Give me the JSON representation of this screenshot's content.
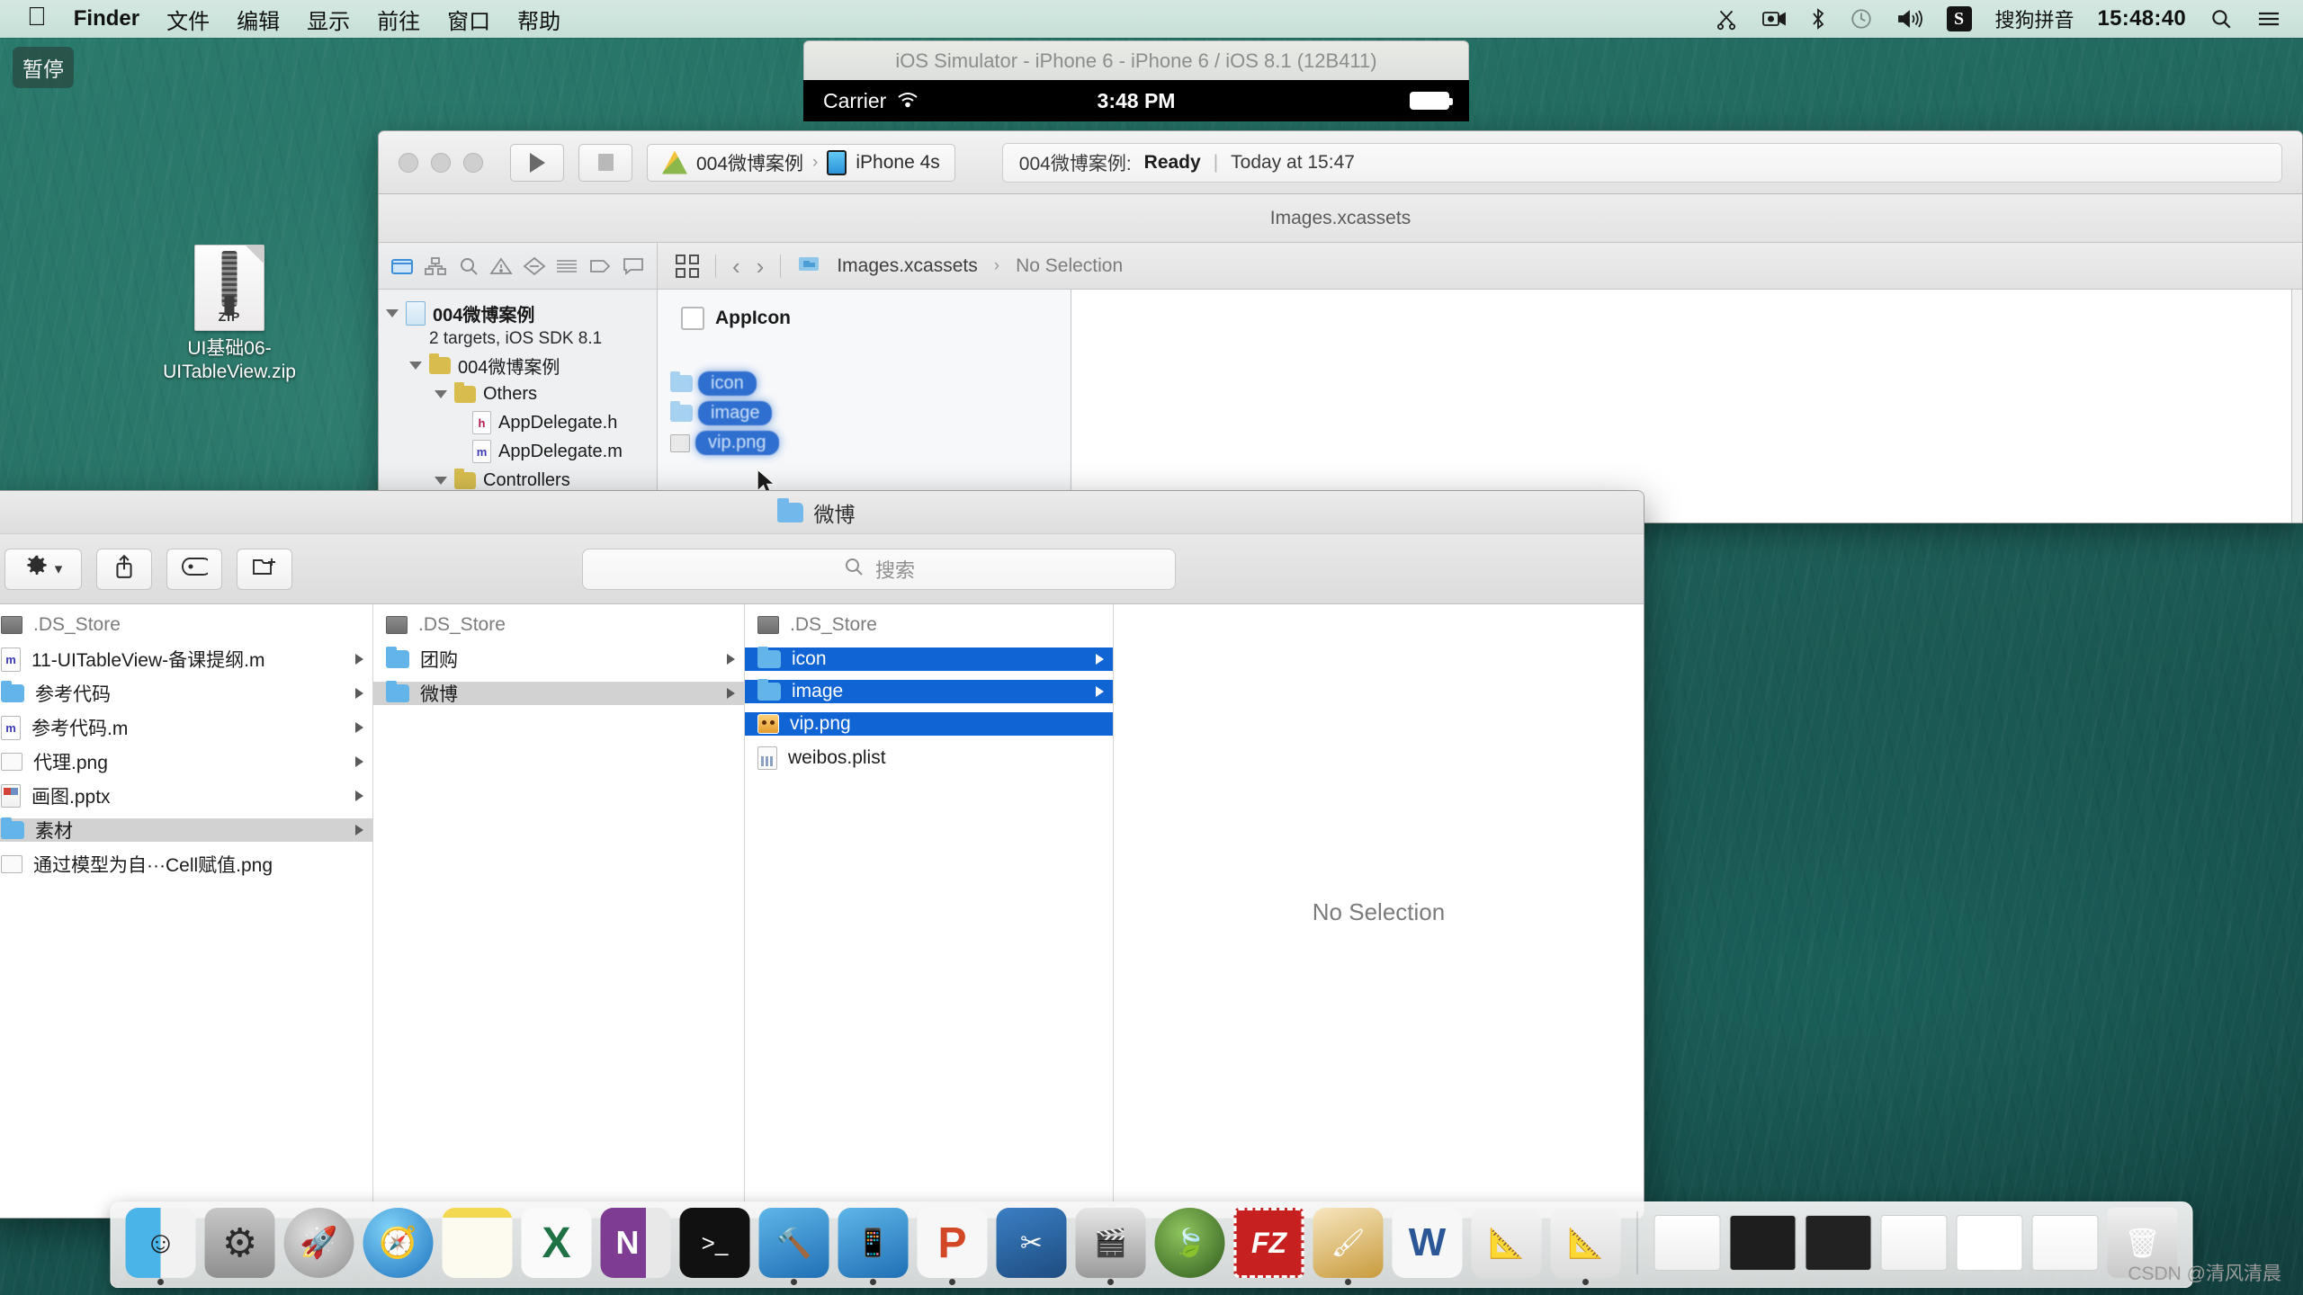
{
  "menubar": {
    "apple_icon": "apple-icon",
    "items": [
      {
        "label": "Finder",
        "bold": true
      },
      {
        "label": "文件",
        "bold": false
      },
      {
        "label": "编辑",
        "bold": false
      },
      {
        "label": "显示",
        "bold": false
      },
      {
        "label": "前往",
        "bold": false
      },
      {
        "label": "窗口",
        "bold": false
      },
      {
        "label": "帮助",
        "bold": false
      }
    ],
    "status_icons": [
      "scissors-icon",
      "screen-record-icon",
      "bluetooth-icon",
      "time-machine-icon",
      "volume-icon"
    ],
    "ime_badge": "S",
    "ime_label": "搜狗拼音",
    "clock": "15:48:40",
    "search_icon": "search-icon",
    "notification_icon": "notification-list-icon"
  },
  "pause_overlay": {
    "label": "暂停"
  },
  "desktop": {
    "zip_file": {
      "name": "UI基础06-UITableView.zip",
      "icon_word": "ZIP"
    }
  },
  "simulator": {
    "title": "iOS Simulator - iPhone 6 - iPhone 6 / iOS 8.1 (12B411)",
    "carrier": "Carrier",
    "wifi_icon": "wifi-icon",
    "time": "3:48 PM",
    "battery_icon": "battery-icon"
  },
  "xcode": {
    "toolbar": {
      "run_icon": "play-icon",
      "stop_icon": "stop-icon",
      "scheme_project": "004微博案例",
      "scheme_separator": "›",
      "scheme_device": "iPhone 4s",
      "status_project": "004微博案例:",
      "status_state": "Ready",
      "status_divider": "|",
      "status_time": "Today at 15:47"
    },
    "subbar_title": "Images.xcassets",
    "navigator": {
      "tabs": [
        "folder-icon",
        "hierarchy-icon",
        "search-icon",
        "warning-icon",
        "issue-icon",
        "test-icon",
        "tag-icon",
        "comment-icon"
      ],
      "tree": [
        {
          "label": "004微博案例",
          "sub": "2 targets, iOS SDK 8.1",
          "indent": 0,
          "icon": "project-icon",
          "bold": true
        },
        {
          "label": "004微博案例",
          "indent": 1,
          "icon": "folder-icon",
          "bold": false
        },
        {
          "label": "Others",
          "indent": 2,
          "icon": "folder-icon",
          "bold": false
        },
        {
          "label": "AppDelegate.h",
          "indent": 3,
          "icon": "header-file-icon",
          "bold": false
        },
        {
          "label": "AppDelegate.m",
          "indent": 3,
          "icon": "source-file-icon",
          "bold": false
        },
        {
          "label": "Controllers",
          "indent": 2,
          "icon": "folder-icon",
          "bold": false
        }
      ]
    },
    "editor": {
      "jump_bar_icon": "jump-bar-icon",
      "back_icon": "chevron-left-icon",
      "forward_icon": "chevron-right-icon",
      "breadcrumb_asset": "Images.xcassets",
      "breadcrumb_sep": "›",
      "breadcrumb_selection": "No Selection",
      "asset_items": [
        "AppIcon"
      ],
      "drag_items": [
        "icon",
        "image",
        "vip.png"
      ],
      "drag_badge_count": "3"
    }
  },
  "finder": {
    "title": "微博",
    "toolbar": {
      "action_icon": "gear-icon",
      "action_chevron": "chevron-down-icon",
      "share_icon": "share-icon",
      "tag_icon": "tag-icon",
      "new_folder_icon": "new-folder-icon"
    },
    "search": {
      "icon": "search-icon",
      "placeholder": "搜索"
    },
    "columns": [
      {
        "name": "column-1",
        "items": [
          {
            "label": ".DS_Store",
            "icon": "ds-store-icon",
            "state": "dim",
            "disclosure": false
          },
          {
            "label": "11-UITableView-备课提纲.m",
            "icon": "source-file-icon",
            "state": "normal",
            "disclosure": true
          },
          {
            "label": "参考代码",
            "icon": "folder-icon",
            "state": "normal",
            "disclosure": true
          },
          {
            "label": "参考代码.m",
            "icon": "source-file-icon",
            "state": "normal",
            "disclosure": true
          },
          {
            "label": "代理.png",
            "icon": "image-icon",
            "state": "normal",
            "disclosure": true
          },
          {
            "label": "画图.pptx",
            "icon": "pptx-icon",
            "state": "normal",
            "disclosure": true
          },
          {
            "label": "素材",
            "icon": "folder-icon",
            "state": "selected-gray",
            "disclosure": true
          },
          {
            "label": "通过模型为自···Cell赋值.png",
            "icon": "image-icon",
            "state": "normal",
            "disclosure": false
          }
        ]
      },
      {
        "name": "column-2",
        "items": [
          {
            "label": ".DS_Store",
            "icon": "ds-store-icon",
            "state": "dim",
            "disclosure": false
          },
          {
            "label": "团购",
            "icon": "folder-icon",
            "state": "normal",
            "disclosure": true
          },
          {
            "label": "微博",
            "icon": "folder-icon",
            "state": "selected-gray",
            "disclosure": true
          }
        ]
      },
      {
        "name": "column-3",
        "items": [
          {
            "label": ".DS_Store",
            "icon": "ds-store-icon",
            "state": "dim",
            "disclosure": false
          },
          {
            "label": "icon",
            "icon": "folder-icon",
            "state": "selected-blue",
            "disclosure": true
          },
          {
            "label": "image",
            "icon": "folder-icon",
            "state": "selected-blue",
            "disclosure": true
          },
          {
            "label": "vip.png",
            "icon": "vip-image-icon",
            "state": "selected-blue",
            "disclosure": false
          },
          {
            "label": "weibos.plist",
            "icon": "plist-icon",
            "state": "normal",
            "disclosure": false
          }
        ]
      }
    ],
    "preview": {
      "no_selection": "No Selection"
    }
  },
  "dock": {
    "apps": [
      {
        "name": "finder",
        "glyph": "😀",
        "color1": "#4ab3e8",
        "color2": "#f2f2f2",
        "running": true
      },
      {
        "name": "system-preferences",
        "glyph": "⚙",
        "color1": "#c7c7c7",
        "color2": "#8f8f8f",
        "running": false
      },
      {
        "name": "launchpad",
        "glyph": "🚀",
        "color1": "#cfcfcf",
        "color2": "#9a9a9a",
        "running": false
      },
      {
        "name": "safari",
        "glyph": "🧭",
        "color1": "#58b6ee",
        "color2": "#1f74bf",
        "running": false
      },
      {
        "name": "notes",
        "glyph": "📝",
        "color1": "#fdf6d8",
        "color2": "#e8c944",
        "running": false
      },
      {
        "name": "excel",
        "glyph": "X",
        "color1": "#f6f6f6",
        "color2": "#1f7244",
        "running": false
      },
      {
        "name": "onenote",
        "glyph": "N",
        "color1": "#7e3c93",
        "color2": "#5b2a6c",
        "running": false
      },
      {
        "name": "terminal",
        "glyph": "➤",
        "color1": "#1a1a1a",
        "color2": "#000000",
        "running": false
      },
      {
        "name": "xcode",
        "glyph": "🔨",
        "color1": "#3a9fe0",
        "color2": "#1e6fb5",
        "running": true
      },
      {
        "name": "xcode-beta",
        "glyph": "📱",
        "color1": "#3a9fe0",
        "color2": "#1e6fb5",
        "running": true
      },
      {
        "name": "powerpoint",
        "glyph": "P",
        "color1": "#f3f3f3",
        "color2": "#d24726",
        "running": true
      },
      {
        "name": "snipping",
        "glyph": "✂",
        "color1": "#2f6fb5",
        "color2": "#1d4c80",
        "running": false
      },
      {
        "name": "video-converter",
        "glyph": "🎬",
        "color1": "#d9d9d9",
        "color2": "#8a8a8a",
        "running": true
      },
      {
        "name": "typo",
        "glyph": "🍃",
        "color1": "#6fa843",
        "color2": "#3b6b22",
        "running": false
      },
      {
        "name": "filezilla",
        "glyph": "FZ",
        "color1": "#c62020",
        "color2": "#8e1313",
        "running": false
      },
      {
        "name": "paint-tool",
        "glyph": "🖌",
        "color1": "#f0c14b",
        "color2": "#c08a20",
        "running": true
      },
      {
        "name": "word",
        "glyph": "W",
        "color1": "#f3f3f3",
        "color2": "#2b5797",
        "running": false
      },
      {
        "name": "app-store",
        "glyph": "A",
        "color1": "#eeeeee",
        "color2": "#c7c7c7",
        "running": false
      },
      {
        "name": "xcode-alt",
        "glyph": "A",
        "color1": "#eeeeee",
        "color2": "#c7c7c7",
        "running": true
      }
    ],
    "minimized_count": 6,
    "trash_icon": "trash-icon"
  },
  "watermark": {
    "text": "CSDN @清风清晨"
  }
}
